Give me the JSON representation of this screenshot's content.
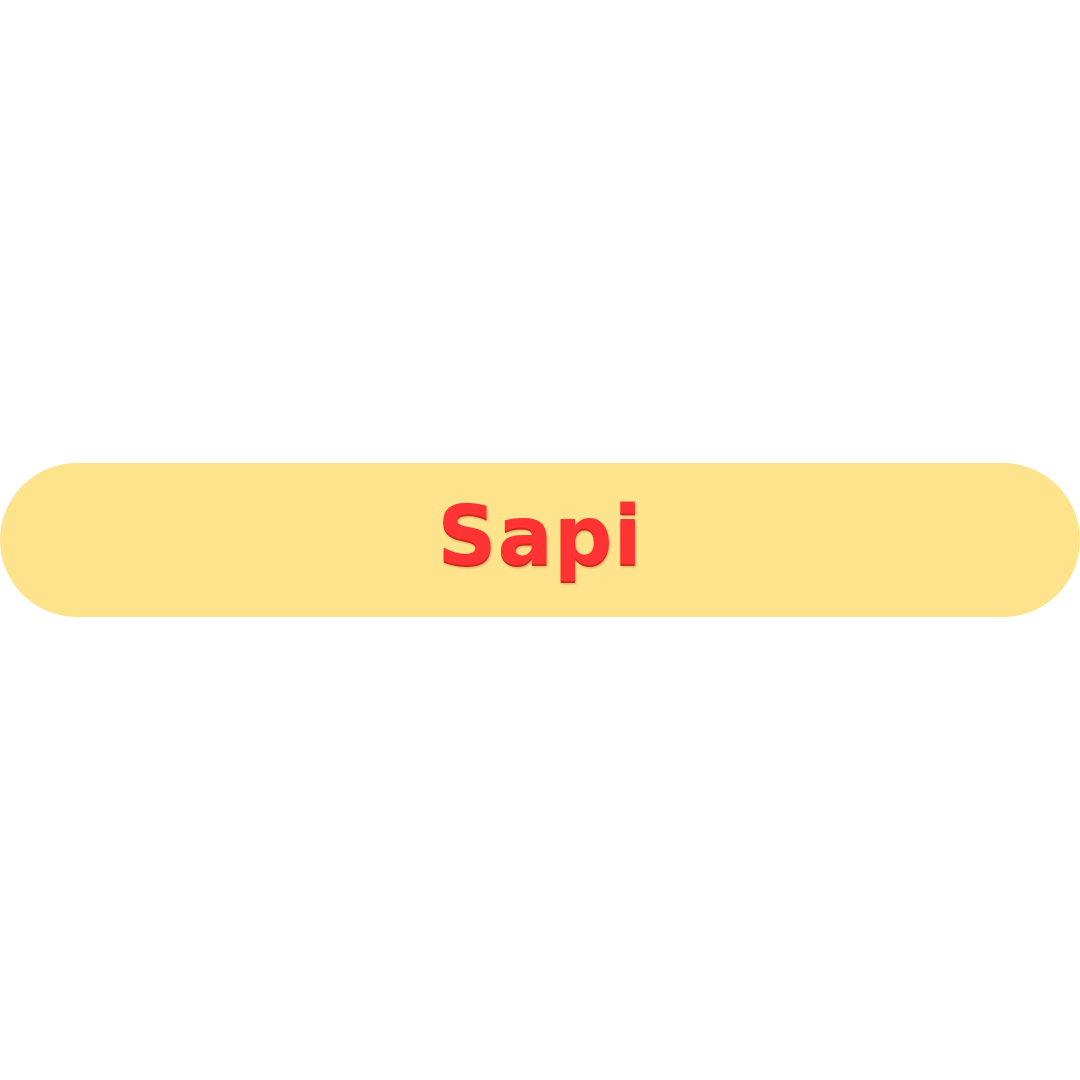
{
  "banner": {
    "word": "Sapi",
    "background_color": "#fde38c",
    "text_color": "#ff3333"
  }
}
